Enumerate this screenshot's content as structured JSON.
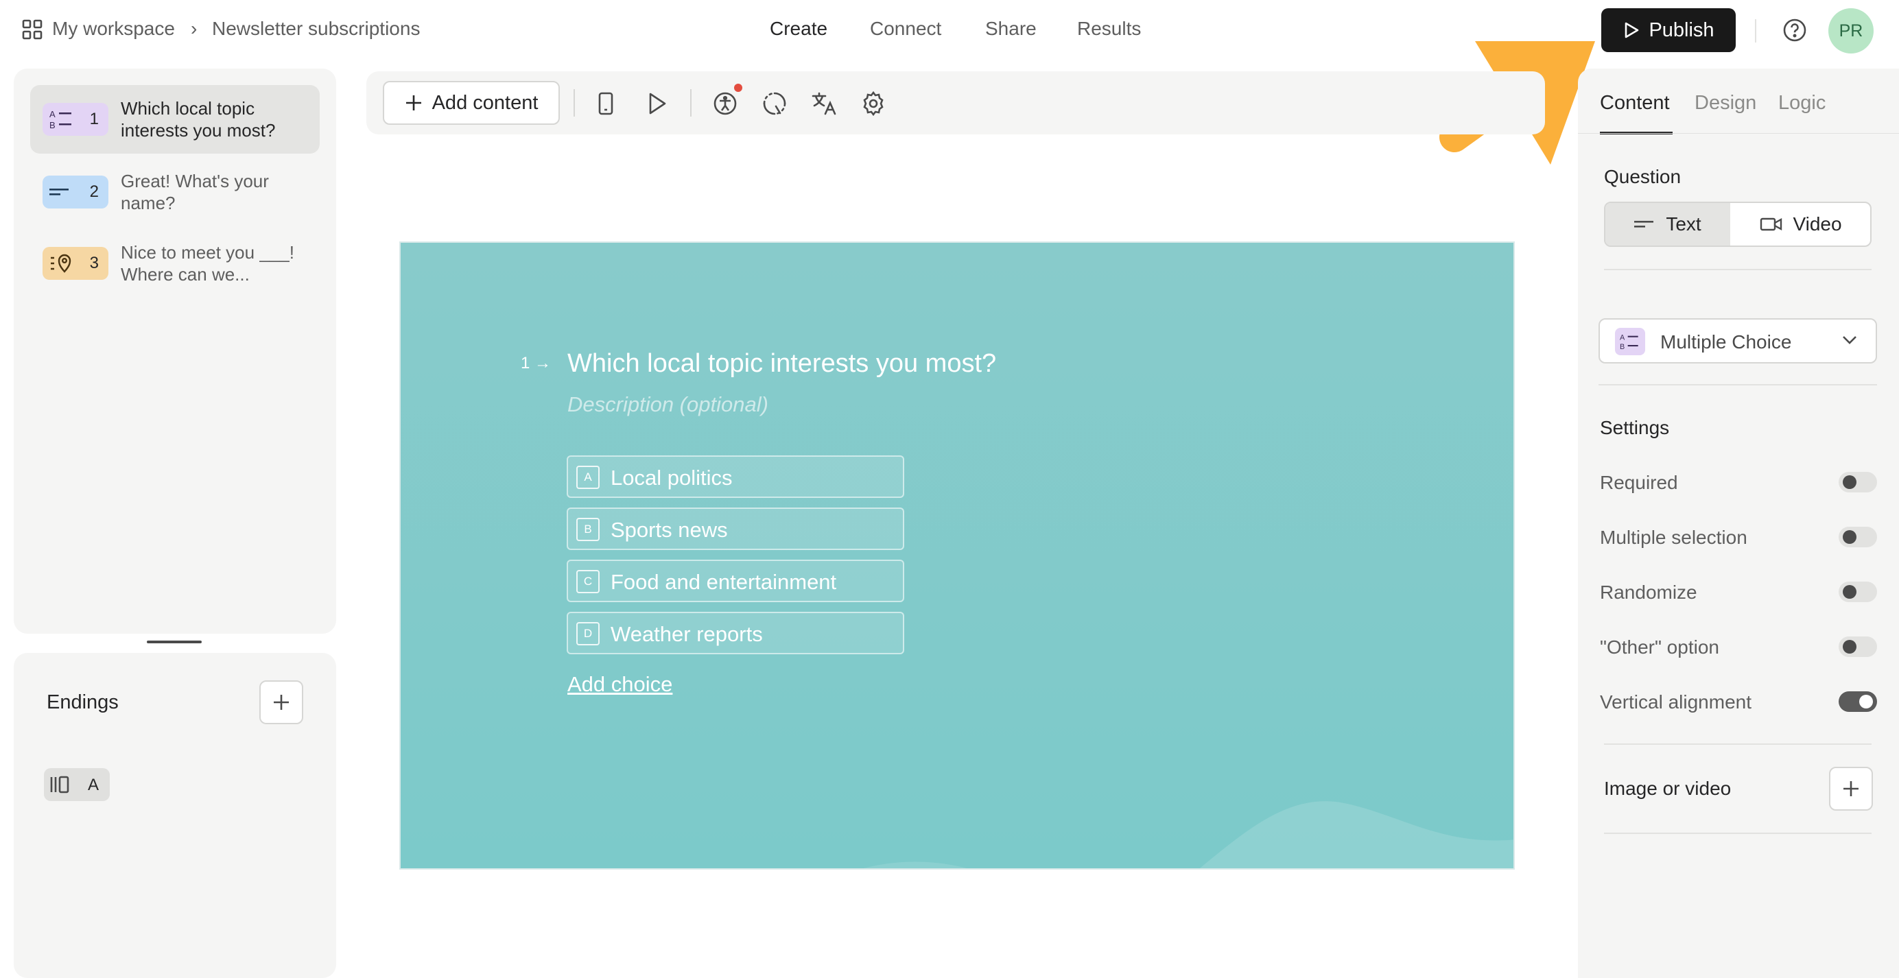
{
  "breadcrumb": {
    "workspace": "My workspace",
    "separator": "›",
    "form": "Newsletter subscriptions"
  },
  "nav": {
    "tabs": [
      "Create",
      "Connect",
      "Share",
      "Results"
    ],
    "active": "Create"
  },
  "header": {
    "publish_label": "Publish",
    "avatar_initials": "PR"
  },
  "questions": [
    {
      "number": "1",
      "text": "Which local topic interests you most?",
      "type_icon": "multiple-choice-icon",
      "badge_color": "#e3d4f5",
      "selected": true
    },
    {
      "number": "2",
      "text": "Great! What's your name?",
      "type_icon": "short-text-icon",
      "badge_color": "#bfdcf8",
      "selected": false
    },
    {
      "number": "3",
      "text": "Nice to meet you ___! Where can we...",
      "type_icon": "location-icon",
      "badge_color": "#f6d7a3",
      "selected": false
    }
  ],
  "endings": {
    "title": "Endings",
    "items": [
      {
        "label": "A",
        "icon": "ending-icon"
      }
    ]
  },
  "toolbar": {
    "add_content_label": "Add content"
  },
  "canvas": {
    "question_number": "1 →",
    "title": "Which local topic interests you most?",
    "description_placeholder": "Description (optional)",
    "choices": [
      {
        "key": "A",
        "label": "Local politics"
      },
      {
        "key": "B",
        "label": "Sports news"
      },
      {
        "key": "C",
        "label": "Food and entertainment"
      },
      {
        "key": "D",
        "label": "Weather reports"
      }
    ],
    "add_choice_label": "Add choice",
    "background_color": "#82caca"
  },
  "right_panel": {
    "tabs": [
      "Content",
      "Design",
      "Logic"
    ],
    "active_tab": "Content",
    "question_label": "Question",
    "question_modes": [
      {
        "label": "Text",
        "active": true
      },
      {
        "label": "Video",
        "active": false
      }
    ],
    "question_type": "Multiple Choice",
    "settings_label": "Settings",
    "settings": [
      {
        "label": "Required",
        "on": false
      },
      {
        "label": "Multiple selection",
        "on": false
      },
      {
        "label": "Randomize",
        "on": false
      },
      {
        "label": "\"Other\" option",
        "on": false
      },
      {
        "label": "Vertical alignment",
        "on": true
      }
    ],
    "image_or_video_label": "Image or video"
  },
  "colors": {
    "publish_bg": "#191919",
    "avatar_bg": "#b8e6c6",
    "arrow": "#fbb03b",
    "notification_dot": "#e34d3f"
  }
}
